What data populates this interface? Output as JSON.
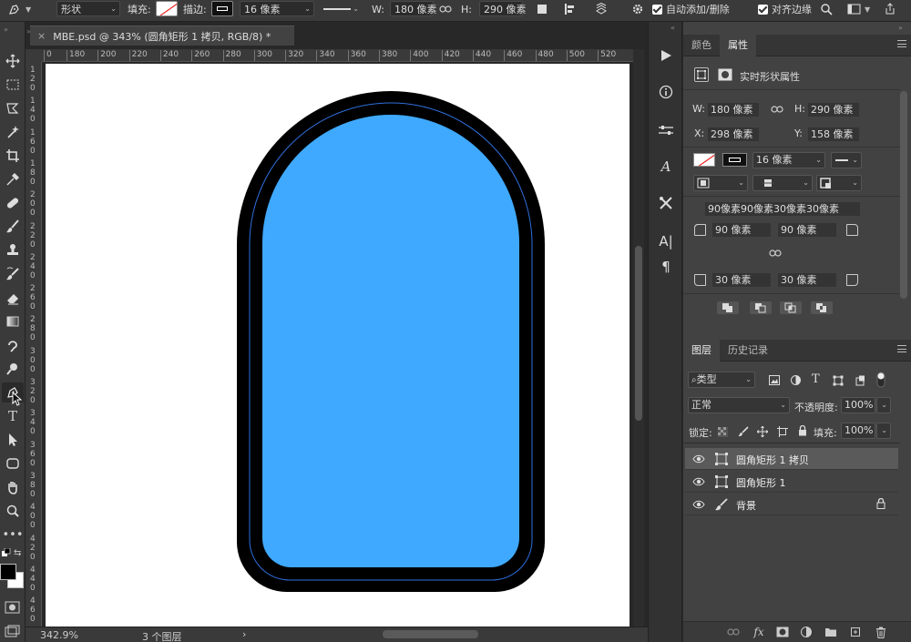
{
  "options_bar": {
    "mode": "形状",
    "fill_label": "填充:",
    "stroke_label": "描边:",
    "stroke_width": "16 像素",
    "w_label": "W:",
    "w_value": "180 像素",
    "h_label": "H:",
    "h_value": "290 像素",
    "auto_add_delete": "自动添加/删除",
    "align_edges": "对齐边缘"
  },
  "document": {
    "tab_title": "MBE.psd @ 343% (圆角矩形 1 拷贝, RGB/8) *",
    "zoom": "342.9%",
    "layers_count": "3 个图层",
    "status_arrow": "›"
  },
  "ruler_top_ticks": [
    "0",
    "180",
    "200",
    "220",
    "240",
    "260",
    "280",
    "300",
    "320",
    "340",
    "360",
    "380",
    "400",
    "420",
    "440",
    "460",
    "480",
    "500",
    "520"
  ],
  "ruler_left_labels": [
    "1 2 0",
    "1 4 0",
    "1 6 0",
    "1 8 0",
    "2 0 0",
    "2 2 0",
    "2 4 0",
    "2 6 0",
    "2 8 0",
    "3 0 0",
    "3 2 0",
    "3 4 0",
    "3 6 0",
    "3 8 0",
    "4 0 0",
    "4 2 0",
    "4 4 0",
    "4 6 0"
  ],
  "shape": {
    "fill_color": "#3fa9ff",
    "stroke_color": "#000000",
    "path_color": "#2f6fdc"
  },
  "properties_panel": {
    "tabs": [
      "颜色",
      "属性"
    ],
    "header": "实时形状属性",
    "w_label": "W:",
    "w_value": "180 像素",
    "h_label": "H:",
    "h_value": "290 像素",
    "x_label": "X:",
    "x_value": "298 像素",
    "y_label": "Y:",
    "y_value": "158 像素",
    "stroke_width": "16 像素",
    "corner_summary": "90像素90像素30像素30像素",
    "corner_tl": "90 像素",
    "corner_tr": "90 像素",
    "corner_bl": "30 像素",
    "corner_br": "30 像素"
  },
  "layers_panel": {
    "tabs": [
      "图层",
      "历史记录"
    ],
    "filter_kind": "类型",
    "blend_mode": "正常",
    "opacity_label": "不透明度:",
    "opacity_value": "100%",
    "lock_label": "锁定:",
    "fill_label": "填充:",
    "fill_value": "100%",
    "layers": [
      {
        "name": "圆角矩形 1 拷贝",
        "selected": true
      },
      {
        "name": "圆角矩形 1",
        "selected": false
      },
      {
        "name": "背景",
        "selected": false,
        "locked": true
      }
    ]
  },
  "colors": {
    "foreground": "#000000",
    "background": "#ffffff"
  }
}
